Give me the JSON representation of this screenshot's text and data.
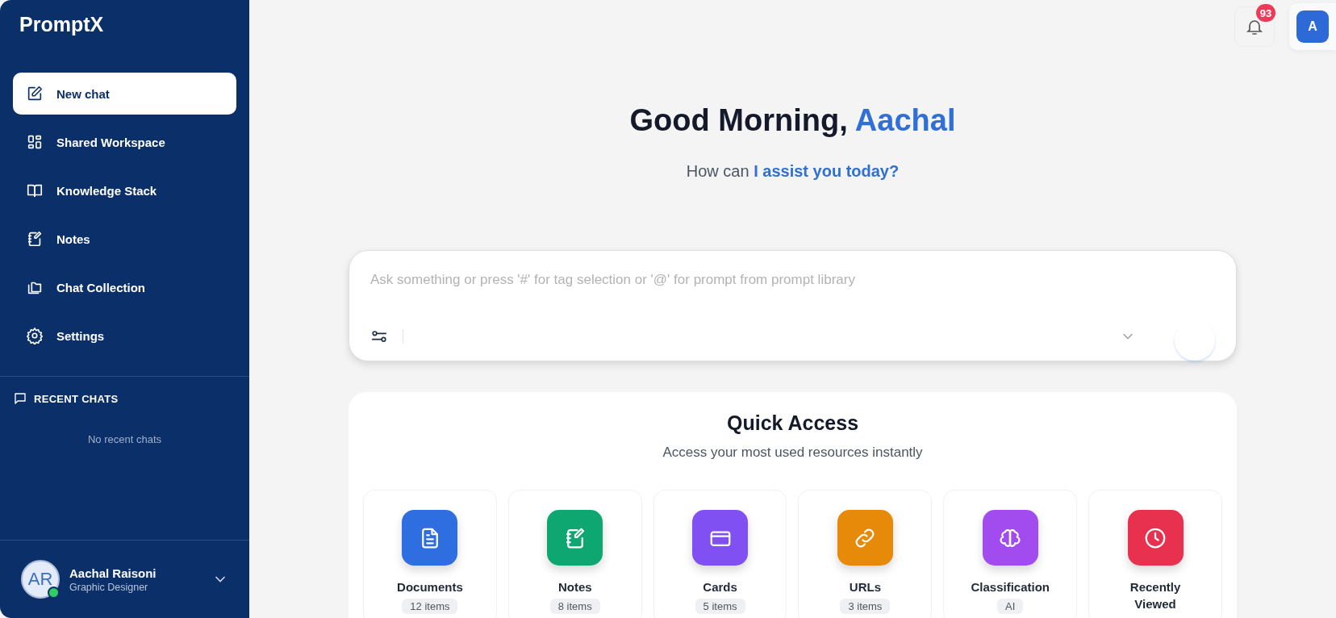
{
  "app": {
    "name": "PromptX"
  },
  "nav": [
    {
      "label": "New chat",
      "selected": true
    },
    {
      "label": "Shared Workspace",
      "selected": false
    },
    {
      "label": "Knowledge Stack",
      "selected": false
    },
    {
      "label": "Notes",
      "selected": false
    },
    {
      "label": "Chat Collection",
      "selected": false
    },
    {
      "label": "Settings",
      "selected": false
    }
  ],
  "recent_chats": {
    "title": "RECENT CHATS",
    "empty_text": "No recent chats"
  },
  "user": {
    "initials": "AR",
    "name": "Aachal Raisoni",
    "role": "Graphic Designer",
    "online": true
  },
  "header": {
    "notification_count": "93",
    "avatar_initial": "A"
  },
  "greeting": {
    "text": "Good Morning, ",
    "name": "Aachal"
  },
  "subtitle": {
    "text": "How can ",
    "highlight": "I assist you today?"
  },
  "prompt": {
    "placeholder": "Ask something or press '#' for tag selection or '@' for prompt from prompt library"
  },
  "quick_access": {
    "title": "Quick Access",
    "subtitle": "Access your most used resources instantly",
    "items": [
      {
        "label": "Documents",
        "badge": "12 items",
        "color": "#2f6ee0"
      },
      {
        "label": "Notes",
        "badge": "8 items",
        "color": "#0fa771"
      },
      {
        "label": "Cards",
        "badge": "5 items",
        "color": "#8150f2"
      },
      {
        "label": "URLs",
        "badge": "3 items",
        "color": "#e78a09"
      },
      {
        "label": "Classification",
        "badge": "AI",
        "color": "#a24cf0"
      },
      {
        "label": "Recently Viewed",
        "color": "#e8304f"
      }
    ]
  }
}
